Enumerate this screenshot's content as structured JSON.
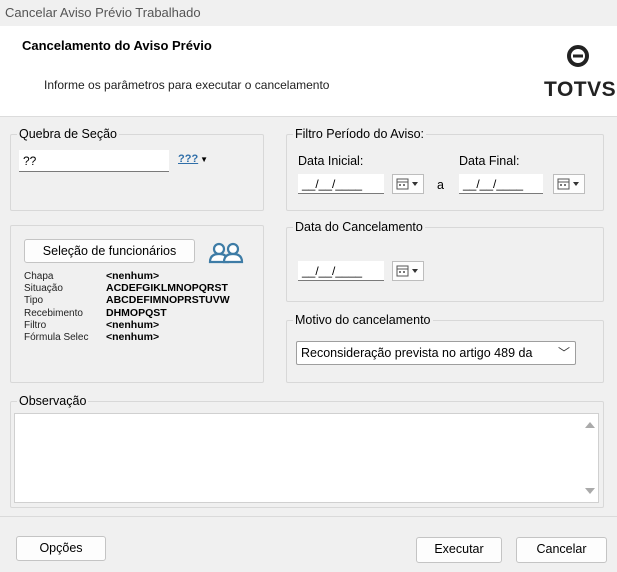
{
  "window": {
    "title": "Cancelar Aviso Prévio Trabalhado"
  },
  "header": {
    "title": "Cancelamento do Aviso Prévio",
    "subtitle": "Informe os parâmetros para executar o cancelamento",
    "logo_text": "TOTVS"
  },
  "quebra": {
    "legend": "Quebra de Seção",
    "value": "??",
    "button_label": "???"
  },
  "filtro": {
    "legend": "Filtro Período do Aviso:",
    "data_inicial_label": "Data Inicial:",
    "data_inicial_value": "__/__/____",
    "separator": "a",
    "data_final_label": "Data Final:",
    "data_final_value": "__/__/____"
  },
  "selecao": {
    "button_label": "Seleção de funcionários",
    "rows": [
      {
        "label": "Chapa",
        "value": "<nenhum>"
      },
      {
        "label": "Situação",
        "value": "ACDEFGIKLMNOPQRST"
      },
      {
        "label": "Tipo",
        "value": "ABCDEFIMNOPRSTUVW"
      },
      {
        "label": "Recebimento",
        "value": "DHMOPQST"
      },
      {
        "label": "Filtro",
        "value": "<nenhum>"
      },
      {
        "label": "Fórmula Selec",
        "value": "<nenhum>"
      }
    ]
  },
  "cancelamento": {
    "legend": "Data do Cancelamento",
    "value": "__/__/____"
  },
  "motivo": {
    "legend": "Motivo do cancelamento",
    "selected": "Reconsideração prevista no artigo 489 da"
  },
  "observacao": {
    "legend": "Observação",
    "value": ""
  },
  "footer": {
    "opcoes": "Opções",
    "executar": "Executar",
    "cancelar": "Cancelar"
  },
  "colors": {
    "accent": "#2f6ea8",
    "people_icon": "#3e7ca6",
    "logo": "#222222"
  }
}
